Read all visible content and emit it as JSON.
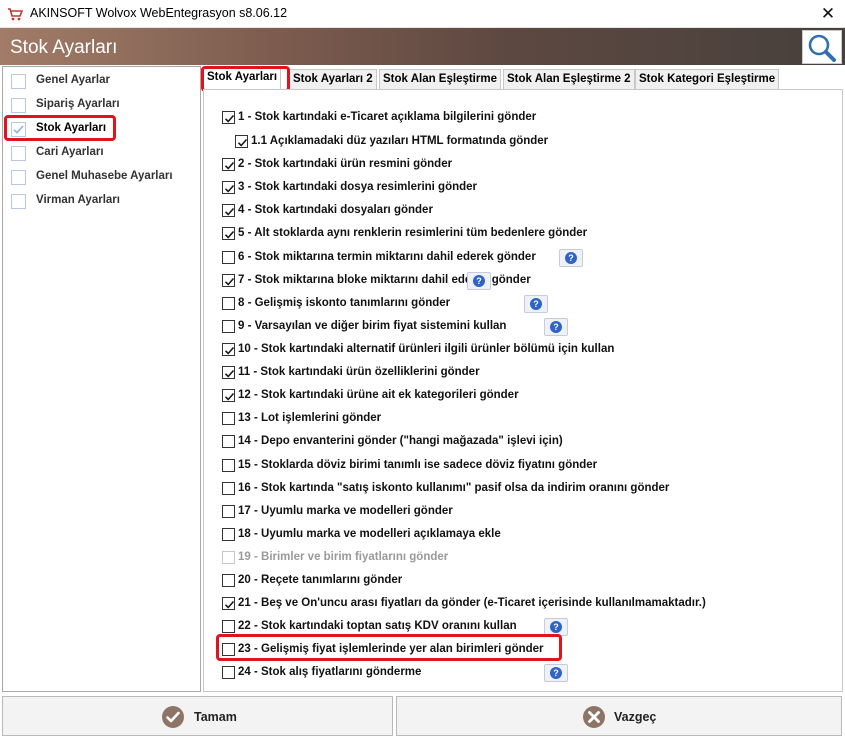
{
  "window": {
    "title": "AKINSOFT Wolvox WebEntegrasyon s8.06.12",
    "close": "✕"
  },
  "header": {
    "title": "Stok Ayarları"
  },
  "sidebar": {
    "items": [
      {
        "label": "Genel Ayarlar",
        "checked": false
      },
      {
        "label": "Sipariş Ayarları",
        "checked": false
      },
      {
        "label": "Stok Ayarları",
        "checked": true,
        "active": true
      },
      {
        "label": "Cari Ayarları",
        "checked": false
      },
      {
        "label": "Genel Muhasebe Ayarları",
        "checked": false
      },
      {
        "label": "Virman Ayarları",
        "checked": false
      }
    ]
  },
  "tabs": [
    {
      "label": "Stok Ayarları",
      "active": true
    },
    {
      "label": "Stok Ayarları 2"
    },
    {
      "label": "Stok Alan Eşleştirme"
    },
    {
      "label": "Stok Alan Eşleştirme 2"
    },
    {
      "label": "Stok Kategori Eşleştirme"
    }
  ],
  "options": [
    {
      "label": "1 - Stok kartındaki e-Ticaret açıklama bilgilerini gönder",
      "checked": true
    },
    {
      "label": "1.1 Açıklamadaki düz yazıları HTML formatında gönder",
      "checked": true,
      "indent": true
    },
    {
      "label": "2 - Stok kartındaki ürün resmini gönder",
      "checked": true
    },
    {
      "label": "3 - Stok kartındaki dosya resimlerini gönder",
      "checked": true
    },
    {
      "label": "4 - Stok kartındaki dosyaları gönder",
      "checked": true
    },
    {
      "label": "5 - Alt stoklarda aynı renklerin resimlerini tüm bedenlere gönder",
      "checked": true
    },
    {
      "label": "6 - Stok miktarına termin miktarını dahil ederek gönder",
      "checked": false,
      "help": true
    },
    {
      "label": "7 - Stok miktarına bloke miktarını dahil ederek gönder",
      "checked": true,
      "help": true
    },
    {
      "label": "8 - Gelişmiş iskonto tanımlarını gönder",
      "checked": false,
      "help": true
    },
    {
      "label": "9 - Varsayılan ve diğer birim fiyat sistemini kullan",
      "checked": false,
      "help": true
    },
    {
      "label": "10 - Stok kartındaki alternatif ürünleri ilgili ürünler bölümü için kullan",
      "checked": true
    },
    {
      "label": "11 - Stok kartındaki ürün özelliklerini gönder",
      "checked": true
    },
    {
      "label": "12 - Stok kartındaki ürüne ait ek kategorileri gönder",
      "checked": true
    },
    {
      "label": "13 - Lot işlemlerini gönder",
      "checked": false
    },
    {
      "label": "14 - Depo envanterini gönder (\"hangi mağazada\" işlevi için)",
      "checked": false
    },
    {
      "label": "15 - Stoklarda döviz birimi tanımlı ise sadece döviz fiyatını gönder",
      "checked": false
    },
    {
      "label": "16 - Stok kartında \"satış iskonto kullanımı\" pasif olsa da indirim oranını gönder",
      "checked": false
    },
    {
      "label": "17 - Uyumlu marka ve modelleri gönder",
      "checked": false
    },
    {
      "label": "18 - Uyumlu marka ve modelleri açıklamaya ekle",
      "checked": false
    },
    {
      "label": "19 - Birimler ve birim fiyatlarını gönder",
      "checked": false,
      "disabled": true
    },
    {
      "label": "20 - Reçete tanımlarını gönder",
      "checked": false
    },
    {
      "label": "21 - Beş ve On'uncu arası fiyatları da gönder (e-Ticaret içerisinde kullanılmamaktadır.)",
      "checked": true
    },
    {
      "label": "22 - Stok kartındaki toptan satış KDV oranını kullan",
      "checked": false,
      "help": true
    },
    {
      "label": "23 - Gelişmiş fiyat işlemlerinde yer alan birimleri gönder",
      "checked": false,
      "highlight": true
    },
    {
      "label": "24 - Stok alış fiyatlarını gönderme",
      "checked": false,
      "help": true
    }
  ],
  "footer": {
    "ok_label": "Tamam",
    "cancel_label": "Vazgeç"
  },
  "colors": {
    "highlight": "#e0141a",
    "check": "#1a1a1a",
    "help_icon": "#2f63c8"
  },
  "icons": {
    "search": "magnifier-icon",
    "ok": "checkmark-circle-icon",
    "cancel": "x-circle-icon",
    "help": "question-icon"
  }
}
